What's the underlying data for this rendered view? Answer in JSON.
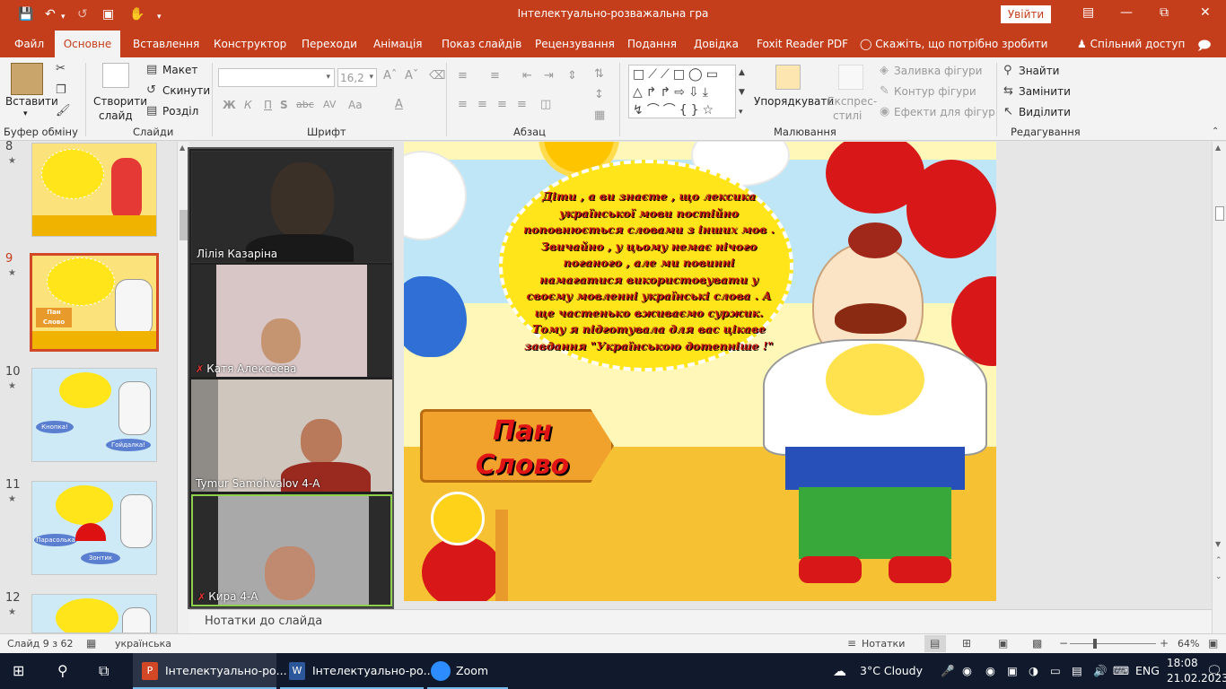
{
  "window": {
    "title": "Інтелектуально-розважальна гра",
    "signin": "Увійти"
  },
  "tabs": [
    "Файл",
    "Основне",
    "Вставлення",
    "Конструктор",
    "Переходи",
    "Анімація",
    "Показ слайдів",
    "Рецензування",
    "Подання",
    "Довідка",
    "Foxit Reader PDF"
  ],
  "tell_me": "Скажіть, що потрібно зробити",
  "share": "Спільний доступ",
  "ribbon": {
    "paste": "Вставити",
    "new_slide_1": "Створити",
    "new_slide_2": "слайд",
    "layout": "Макет",
    "reset": "Скинути",
    "section": "Розділ",
    "font_size": "16,2",
    "bold": "Ж",
    "italic": "К",
    "underline": "П",
    "strike": "abc",
    "spacing": "AV",
    "case": "Aa",
    "arrange": "Упорядкувати",
    "quick_styles_1": "Експрес-",
    "quick_styles_2": "стилі",
    "shape_fill": "Заливка фігури",
    "shape_outline": "Контур фігури",
    "shape_effects": "Ефекти для фігур",
    "find": "Знайти",
    "replace": "Замінити",
    "select": "Виділити",
    "groups": {
      "clipboard": "Буфер обміну",
      "slides": "Слайди",
      "font": "Шрифт",
      "paragraph": "Абзац",
      "drawing": "Малювання",
      "editing": "Редагування"
    }
  },
  "slides": [
    {
      "num": "8"
    },
    {
      "num": "9",
      "label1": "Пан",
      "label2": "Слово"
    },
    {
      "num": "10",
      "label1": "Кнопка!",
      "label2": "Гойдалка!"
    },
    {
      "num": "11",
      "label1": "Парасолька",
      "label2": "Зонтик"
    },
    {
      "num": "12"
    }
  ],
  "participants": [
    {
      "name": "Лілія Казаріна",
      "muted": false
    },
    {
      "name": "Катя Алексеева",
      "muted": true
    },
    {
      "name": "Tymur Samohvalov 4-А",
      "muted": false
    },
    {
      "name": "Кира 4-А",
      "muted": true
    }
  ],
  "slide": {
    "speech": "Діти , а ви знаєте , що лексика української мови постійно поповнюється словами з інших мов . Звичайно , у цьому немає нічого поганого , але ми повинні намагатися використовувати у своєму мовленні українські слова . А ще частенько вживаємо суржик. Тому я підготувала для вас цікаве завдання \"Українською дотепніше !\"",
    "sign1": "Пан",
    "sign2": "Слово"
  },
  "notes": "Нотатки до слайда",
  "status": {
    "slide_count": "Слайд 9 з 62",
    "language": "українська",
    "notes_btn": "Нотатки",
    "zoom": "64%"
  },
  "taskbar": {
    "apps": [
      "Інтелектуально-ро...",
      "Інтелектуально-ро...",
      "Zoom"
    ],
    "weather": "3°C  Cloudy",
    "lang": "ENG",
    "time": "18:08",
    "date": "21.02.2023"
  },
  "colors": {
    "accent": "#c43e1c",
    "taskbar": "#101a2c"
  }
}
